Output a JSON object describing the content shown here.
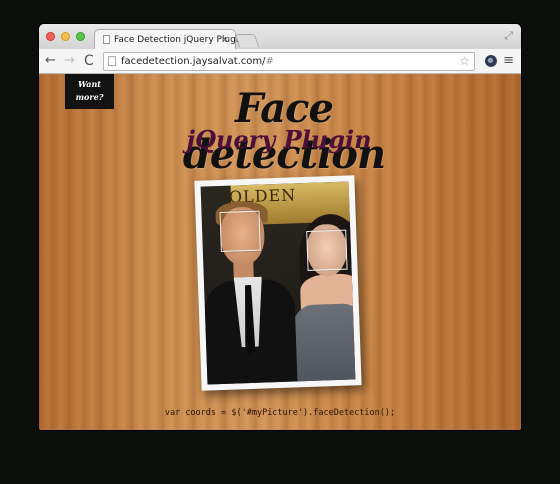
{
  "browser": {
    "tab_title": "Face Detection jQuery Plugin",
    "tab_close": "×",
    "url_host": "facedetection.jaysalvat.com/",
    "url_tail": "#",
    "back": "←",
    "forward": "→",
    "reload": "C",
    "star": "☆",
    "menu": "≡",
    "fullscreen": "⤢"
  },
  "page": {
    "want_more_line1": "Want",
    "want_more_line2": "more?",
    "title": "Face detection",
    "subtitle": "jQuery Plugin",
    "photo_sign_text": "OLDEN",
    "code": "var coords = $('#myPicture').faceDetection();"
  },
  "colors": {
    "wood": "#c98a4c",
    "title": "#111111",
    "subtitle": "#4d0f3a",
    "face_box": "#f2f2f2"
  },
  "icons": [
    "close-dot-icon",
    "minimize-dot-icon",
    "maximize-dot-icon",
    "page-icon",
    "star-icon",
    "extension-icon",
    "menu-icon",
    "fullscreen-icon"
  ]
}
